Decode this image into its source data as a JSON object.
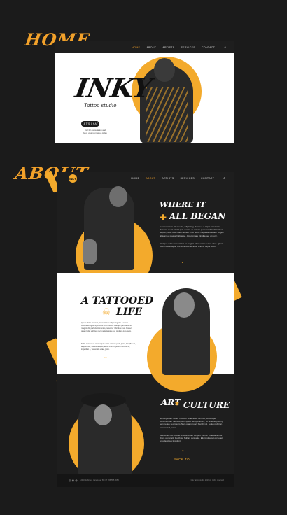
{
  "labels": {
    "home": "HOME",
    "about": "ABOUT"
  },
  "nav": {
    "items": [
      "HOME",
      "ABOUT",
      "ARTISTS",
      "SERVICES",
      "CONTACT"
    ],
    "active_home": 0,
    "active_about": 1
  },
  "hero": {
    "logo": "INKY",
    "subtitle": "Tattoo studio",
    "cta": "LET'S CHAT",
    "caption_line1": "Call for consultation and",
    "caption_line2": "book your next tattoo today"
  },
  "about": {
    "heading1_line1": "WHERE IT",
    "heading1_line2": "ALL BEGAN",
    "para1": "In lorem lorem elit mauris, adipiscing. Semper ut turpis accumsan. Posuere at est id nisl quis viverra. In mauris placerat phasellus risus. Sapien, nulla vitae diam laoreet. Orci purus vulputate sodales. Augue aliquam et massa habitasse. Amet ornare fringilla sed ut nunc.",
    "para2": "Tristique nulla consectetur ac feugiat. Nunc nunc sed sit vitae. Quam lorem scelerisque, tincidunt id. Faucibus, cras ut turpis dolor.",
    "heading2_line1": "A TATTOOED",
    "heading2_line2": "LIFE",
    "para3": "Ipsum dolor sit amet, consectetur adipiscing elit. Aenean commodo ligula eget dolor. Cum sociis natoque penatibus et magnis dis parturient montes, nascetur ridiculus mus. Donec quam felis, ultricies nec, pellentesque eu, pretium quis, sem.",
    "para4": "Nulla consequat massa quis enim. Donec pede justo, fringilla vel, aliquet nec, vulputate eget, arcu. In enim justo, rhoncus ut, imperdiet a, venenatis vitae, justo.",
    "heading3_line1": "ART",
    "heading3_line2": "CULTURE",
    "para5": "Nam eget dui. Etiam rhoncus. Maecenas tempus, tellus eget condimentum rhoncus, sem quam semper libero, sit amet adipiscing sem neque sed ipsum. Nam quam nunc, blandit vel, luctus pulvinar, hendrerit id, lorem.",
    "para6": "Maecenas nec odio et ante tincidunt tempus. Donec vitae sapien ut libero venenatis faucibus. Nullam quis ante. Etiam sit amet orci eget eros faucibus tincidunt.",
    "back_to_top": "BACK TO"
  },
  "footer": {
    "address": "1234 Ink Street, Vancouver BC  |  T 555 555 5555",
    "copyright": "Inky tattoo studio 2019 All rights reserved"
  },
  "colors": {
    "accent": "#f3aa2c",
    "dark": "#1e1e1e",
    "bg": "#1b1b1b"
  }
}
